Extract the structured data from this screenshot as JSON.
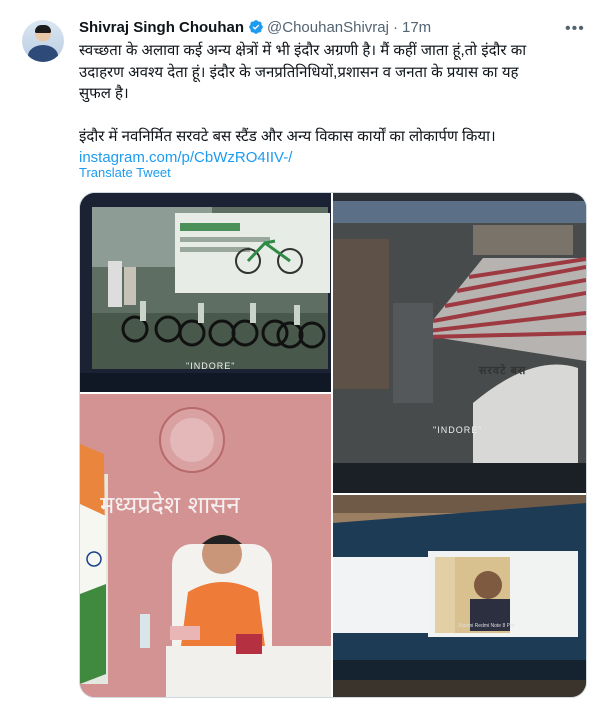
{
  "tweet": {
    "author_name": "Shivraj Singh Chouhan",
    "handle": "@ChouhanShivraj",
    "separator": "·",
    "time": "17m",
    "more_label": "•••",
    "text_line1": "स्वच्छता के अलावा कई अन्य क्षेत्रों में भी इंदौर अग्रणी है। मैं कहीं जाता हूं,तो इंदौर का",
    "text_line2": "उदाहरण अवश्य देता हूं। इंदौर के जनप्रतिनिधियों,प्रशासन व जनता के प्रयास का यह",
    "text_line3": "सुफल है।",
    "text_line4": "इंदौर में नवनिर्मित सरवटे बस स्टैंड और अन्य विकास कार्यों का लोकार्पण किया।",
    "link": "instagram.com/p/CbWzRO4IIV-/",
    "translate_label": "Translate Tweet"
  },
  "media": {
    "photo1_caption": "\"INDORE\"",
    "photo2_caption": "\"INDORE\"",
    "photo2_sign": "सरवटे बस",
    "photo3_banner": "मध्यप्रदेश शासन",
    "photo4_label": "Xiaomi Redmi Note 8 Pro"
  },
  "colors": {
    "accent": "#1d9bf0",
    "secondary": "#536471",
    "border": "#cfd9de"
  }
}
